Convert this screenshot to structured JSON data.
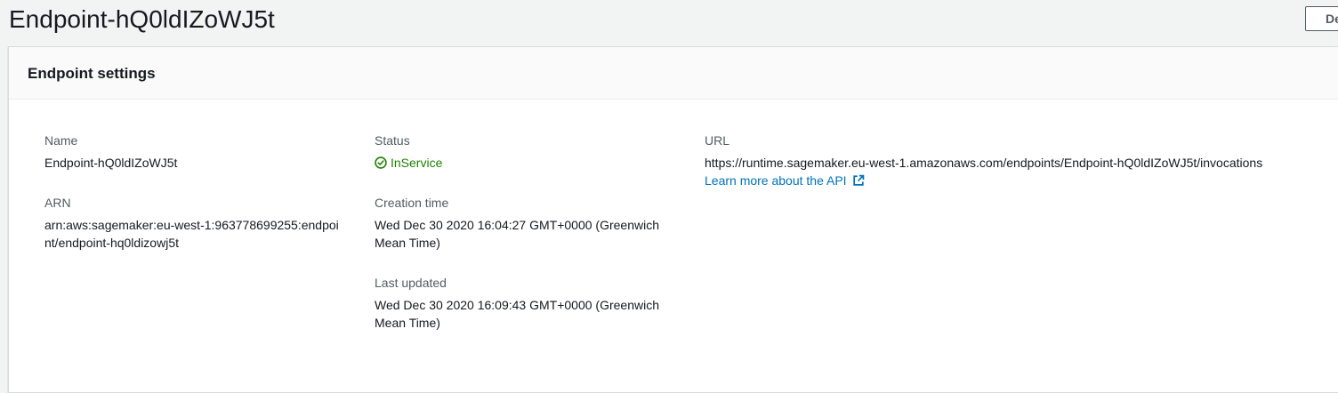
{
  "page": {
    "title": "Endpoint-hQ0ldIZoWJ5t",
    "header_button_label": "Delete"
  },
  "settings": {
    "title": "Endpoint settings",
    "name": {
      "label": "Name",
      "value": "Endpoint-hQ0ldIZoWJ5t"
    },
    "arn": {
      "label": "ARN",
      "value": "arn:aws:sagemaker:eu-west-1:963778699255:endpoint/endpoint-hq0ldizowj5t"
    },
    "status": {
      "label": "Status",
      "value": "InService",
      "icon": "check-circle-icon",
      "color": "#1d8102"
    },
    "creation_time": {
      "label": "Creation time",
      "value": "Wed Dec 30 2020 16:04:27 GMT+0000 (Greenwich Mean Time)"
    },
    "last_updated": {
      "label": "Last updated",
      "value": "Wed Dec 30 2020 16:09:43 GMT+0000 (Greenwich Mean Time)"
    },
    "url": {
      "label": "URL",
      "value": "https://runtime.sagemaker.eu-west-1.amazonaws.com/endpoints/Endpoint-hQ0ldIZoWJ5t/invocations",
      "link_text": "Learn more about the API",
      "link_icon": "external-link-icon",
      "link_color": "#0073bb"
    }
  }
}
